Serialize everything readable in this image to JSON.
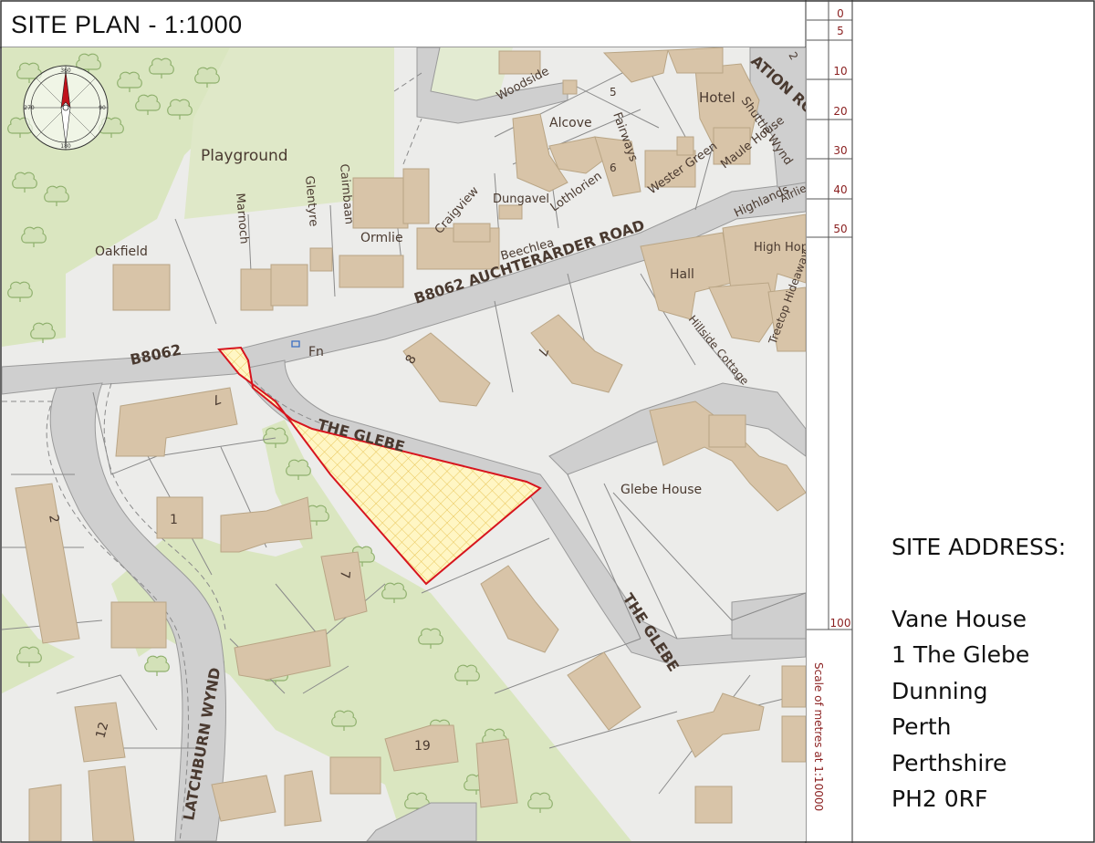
{
  "title": "SITE PLAN - 1:1000",
  "address": {
    "heading": "SITE ADDRESS:",
    "lines": [
      "Vane House",
      "1 The Glebe",
      "Dunning",
      "Perth",
      "Perthshire",
      "PH2 0RF"
    ]
  },
  "scale": {
    "caption": "Scale of metres at 1:10000",
    "ticks": [
      "0",
      "5",
      "10",
      "20",
      "30",
      "40",
      "50",
      "100"
    ]
  },
  "compass": {
    "top": "360",
    "left": "270",
    "right": "90",
    "bottom": "180"
  },
  "map_labels": {
    "road_main": "B8062 AUCHTERARDER ROAD",
    "road_b": "B8062",
    "glebe_1": "THE GLEBE",
    "glebe_2": "THE GLEBE",
    "latchburn": "LATCHBURN WYND",
    "station": "ATION RO",
    "playground": "Playground",
    "oakfield": "Oakfield",
    "marnoch": "Marnoch",
    "glentyre": "Glentyre",
    "cairnbaan": "Cairnbaan",
    "ormlie": "Ormlie",
    "craigview": "Craigview",
    "dungavel": "Dungavel",
    "beechlea": "Beechlea",
    "alcove": "Alcove",
    "fairways": "Fairways",
    "lothlorien": "Lothlorien",
    "wester_green": "Wester Green",
    "woodside": "Woodside",
    "hotel": "Hotel",
    "shuttle_wynd": "Shuttle Wynd",
    "maule_house": "Maule House",
    "highlands": "Highlands",
    "airlie": "Airlie",
    "high_hop_cottage": "High Hop Cottage",
    "hall": "Hall",
    "treetop_hideaway": "Treetop Hideaway",
    "hillside_cottage": "Hillside Cottage",
    "glebe_house": "Glebe House",
    "fn": "Fn",
    "n5": "5",
    "n6": "6",
    "n8": "8",
    "n7a": "7",
    "n7b": "7",
    "n7c": "7",
    "n1": "1",
    "n2": "2",
    "n12": "12",
    "n19": "19",
    "n2b": "2"
  },
  "colors": {
    "land": "#eeeeec",
    "road": "#cdcdcd",
    "building": "#d7c4a9",
    "green": "#d9e5bf",
    "site_outline": "#d7141e",
    "site_fill": "#fff6c4"
  }
}
